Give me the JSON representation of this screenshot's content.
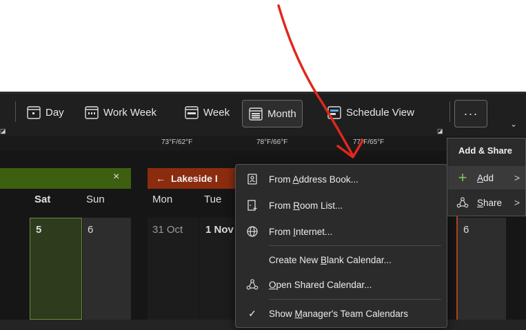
{
  "ribbon": {
    "day_label": "Day",
    "work_week_label": "Work Week",
    "week_label": "Week",
    "month_label": "Month",
    "schedule_view_label": "Schedule View",
    "more_label": "···",
    "chevron": "⌄"
  },
  "weather": {
    "t1": "73°F/62°F",
    "t2": "78°F/66°F",
    "t3": "77°F/65°F"
  },
  "calendar_left": {
    "close": "×",
    "days": [
      "Sat",
      "Sun"
    ],
    "dates": [
      "5",
      "6"
    ]
  },
  "calendar_right": {
    "header": "Lakeside I",
    "arrow": "←",
    "days": [
      "Mon",
      "Tue"
    ],
    "dates": [
      "31 Oct",
      "1 Nov"
    ],
    "extra_date": "6"
  },
  "menu": {
    "address_book": {
      "pre": "From ",
      "u": "A",
      "post": "ddress Book..."
    },
    "room_list": {
      "pre": "From ",
      "u": "R",
      "post": "oom List..."
    },
    "internet": {
      "pre": "From ",
      "u": "I",
      "post": "nternet..."
    },
    "blank": {
      "pre": "Create New ",
      "u": "B",
      "post": "lank Calendar..."
    },
    "shared": {
      "pre": "",
      "u": "O",
      "post": "pen Shared Calendar..."
    },
    "manager": {
      "pre": "Show ",
      "u": "M",
      "post": "anager's Team Calendars"
    },
    "check": "✓"
  },
  "submenu": {
    "title": "Add & Share",
    "add": {
      "u": "A",
      "post": "dd"
    },
    "share": {
      "u": "S",
      "post": "hare"
    },
    "chevron": ">"
  }
}
